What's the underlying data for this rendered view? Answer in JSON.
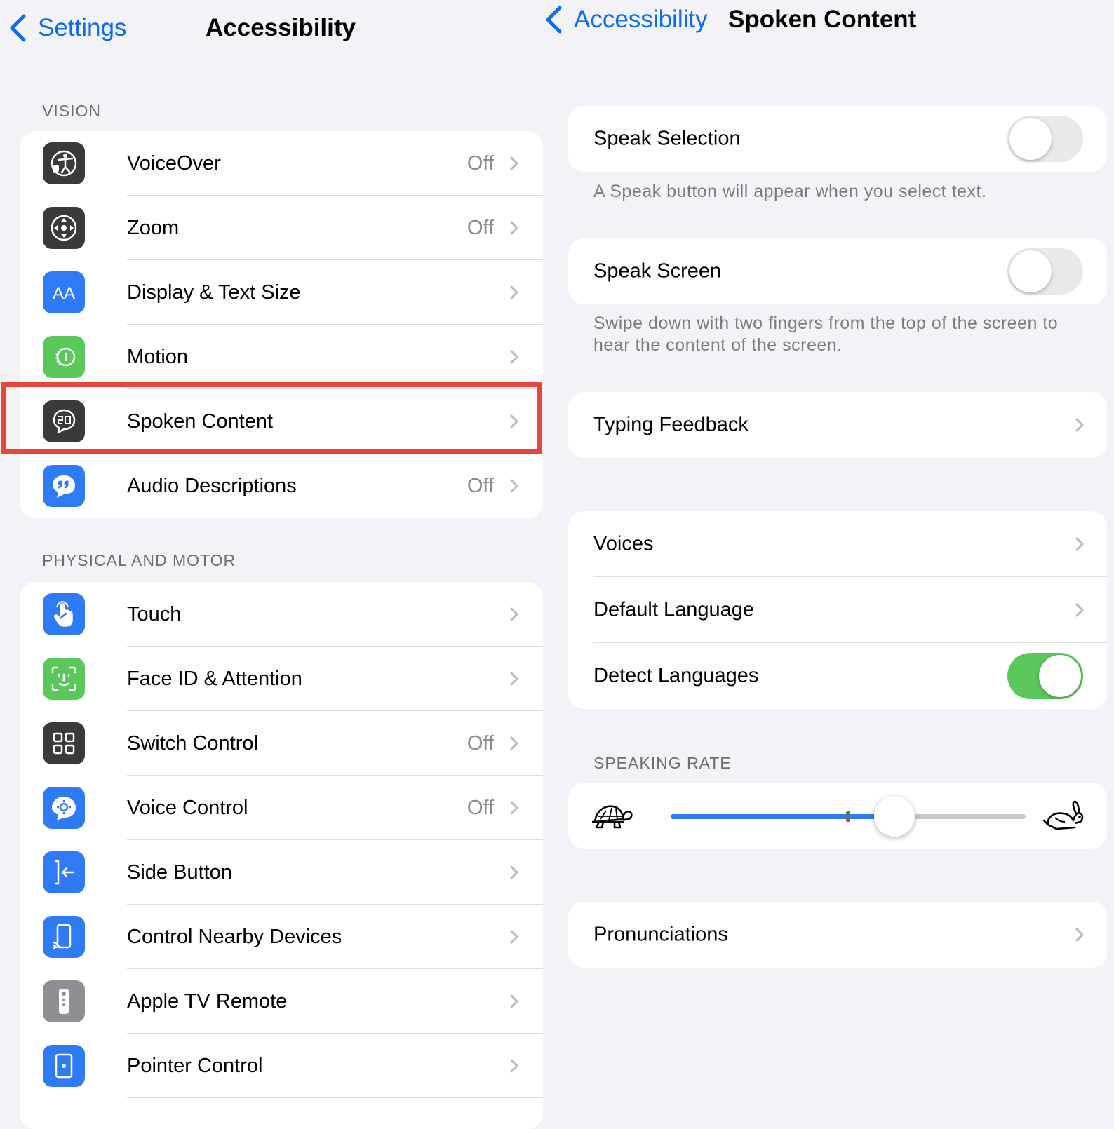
{
  "left": {
    "back_label": "Settings",
    "title": "Accessibility",
    "vision_header": "VISION",
    "vision_items": [
      {
        "label": "VoiceOver",
        "value": "Off",
        "icon": "voiceover-icon",
        "color": "#3a3a3c"
      },
      {
        "label": "Zoom",
        "value": "Off",
        "icon": "zoom-icon",
        "color": "#3a3a3c"
      },
      {
        "label": "Display & Text Size",
        "value": "",
        "icon": "text-size-icon",
        "color": "#2f7af5"
      },
      {
        "label": "Motion",
        "value": "",
        "icon": "motion-icon",
        "color": "#5ac85a"
      },
      {
        "label": "Spoken Content",
        "value": "",
        "icon": "spoken-content-icon",
        "color": "#3a3a3c"
      },
      {
        "label": "Audio Descriptions",
        "value": "Off",
        "icon": "audio-descriptions-icon",
        "color": "#2f7af5"
      }
    ],
    "physical_header": "PHYSICAL AND MOTOR",
    "physical_items": [
      {
        "label": "Touch",
        "value": "",
        "icon": "touch-icon",
        "color": "#2f7af5"
      },
      {
        "label": "Face ID & Attention",
        "value": "",
        "icon": "face-id-icon",
        "color": "#5ac85a"
      },
      {
        "label": "Switch Control",
        "value": "Off",
        "icon": "switch-control-icon",
        "color": "#3a3a3c"
      },
      {
        "label": "Voice Control",
        "value": "Off",
        "icon": "voice-control-icon",
        "color": "#2f7af5"
      },
      {
        "label": "Side Button",
        "value": "",
        "icon": "side-button-icon",
        "color": "#2f7af5"
      },
      {
        "label": "Control Nearby Devices",
        "value": "",
        "icon": "nearby-devices-icon",
        "color": "#2f7af5"
      },
      {
        "label": "Apple TV Remote",
        "value": "",
        "icon": "tv-remote-icon",
        "color": "#8e8e93"
      },
      {
        "label": "Pointer Control",
        "value": "",
        "icon": "pointer-control-icon",
        "color": "#2f7af5"
      }
    ]
  },
  "right": {
    "back_label": "Accessibility",
    "title": "Spoken Content",
    "speak_selection": {
      "label": "Speak Selection",
      "on": false
    },
    "speak_selection_note": "A Speak button will appear when you select text.",
    "speak_screen": {
      "label": "Speak Screen",
      "on": false
    },
    "speak_screen_note": "Swipe down with two fingers from the top of the screen to hear the content of the screen.",
    "typing_feedback": "Typing Feedback",
    "voices": "Voices",
    "default_language": "Default Language",
    "detect_languages": {
      "label": "Detect Languages",
      "on": true
    },
    "speaking_rate_header": "SPEAKING RATE",
    "speaking_rate_level": 0.63,
    "pronunciations": "Pronunciations"
  },
  "colors": {
    "accent": "#0a6cf0",
    "toggle_on": "#5ac85a",
    "highlight": "#e84638"
  }
}
